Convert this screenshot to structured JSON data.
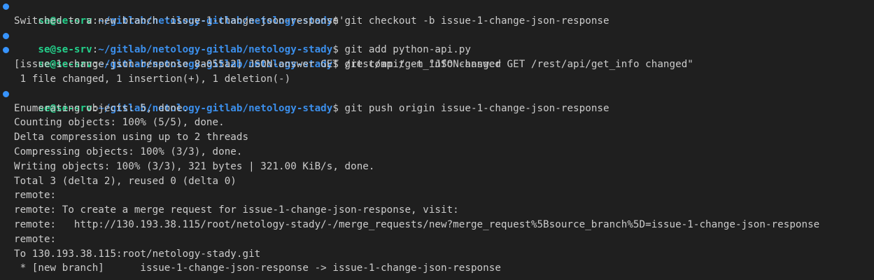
{
  "colors": {
    "background": "#1f1f1f",
    "text": "#cccccc",
    "prompt_user": "#23d18b",
    "prompt_path": "#3b8eea",
    "command_marker": "#3794ff"
  },
  "lines": [
    {
      "type": "prompt",
      "user": "se@se-srv",
      "sep": ":",
      "path": "~/gitlab/netology-gitlab/netology-stady",
      "dollar": "$",
      "command": " git checkout -b issue-1-change-json-response"
    },
    {
      "type": "output",
      "text": "Switched to a new branch 'issue-1-change-json-response'"
    },
    {
      "type": "prompt",
      "user": "se@se-srv",
      "sep": ":",
      "path": "~/gitlab/netology-gitlab/netology-stady",
      "dollar": "$",
      "command": " git add python-api.py"
    },
    {
      "type": "prompt",
      "user": "se@se-srv",
      "sep": ":",
      "path": "~/gitlab/netology-gitlab/netology-stady",
      "dollar": "$",
      "command": " git commit -m \"JSON-answer GET /rest/api/get_info changed\""
    },
    {
      "type": "output",
      "text": "[issue-1-change-json-response 8a055a2] JSON-answer GET /rest/api/get_info changed"
    },
    {
      "type": "output",
      "text": " 1 file changed, 1 insertion(+), 1 deletion(-)"
    },
    {
      "type": "prompt",
      "user": "se@se-srv",
      "sep": ":",
      "path": "~/gitlab/netology-gitlab/netology-stady",
      "dollar": "$",
      "command": " git push origin issue-1-change-json-response"
    },
    {
      "type": "output",
      "text": "Enumerating objects: 5, done."
    },
    {
      "type": "output",
      "text": "Counting objects: 100% (5/5), done."
    },
    {
      "type": "output",
      "text": "Delta compression using up to 2 threads"
    },
    {
      "type": "output",
      "text": "Compressing objects: 100% (3/3), done."
    },
    {
      "type": "output",
      "text": "Writing objects: 100% (3/3), 321 bytes | 321.00 KiB/s, done."
    },
    {
      "type": "output",
      "text": "Total 3 (delta 2), reused 0 (delta 0)"
    },
    {
      "type": "output",
      "text": "remote:"
    },
    {
      "type": "output",
      "text": "remote: To create a merge request for issue-1-change-json-response, visit:"
    },
    {
      "type": "output",
      "text": "remote:   http://130.193.38.115/root/netology-stady/-/merge_requests/new?merge_request%5Bsource_branch%5D=issue-1-change-json-response"
    },
    {
      "type": "output",
      "text": "remote:"
    },
    {
      "type": "output",
      "text": "To 130.193.38.115:root/netology-stady.git"
    },
    {
      "type": "output",
      "text": " * [new branch]      issue-1-change-json-response -> issue-1-change-json-response"
    }
  ]
}
